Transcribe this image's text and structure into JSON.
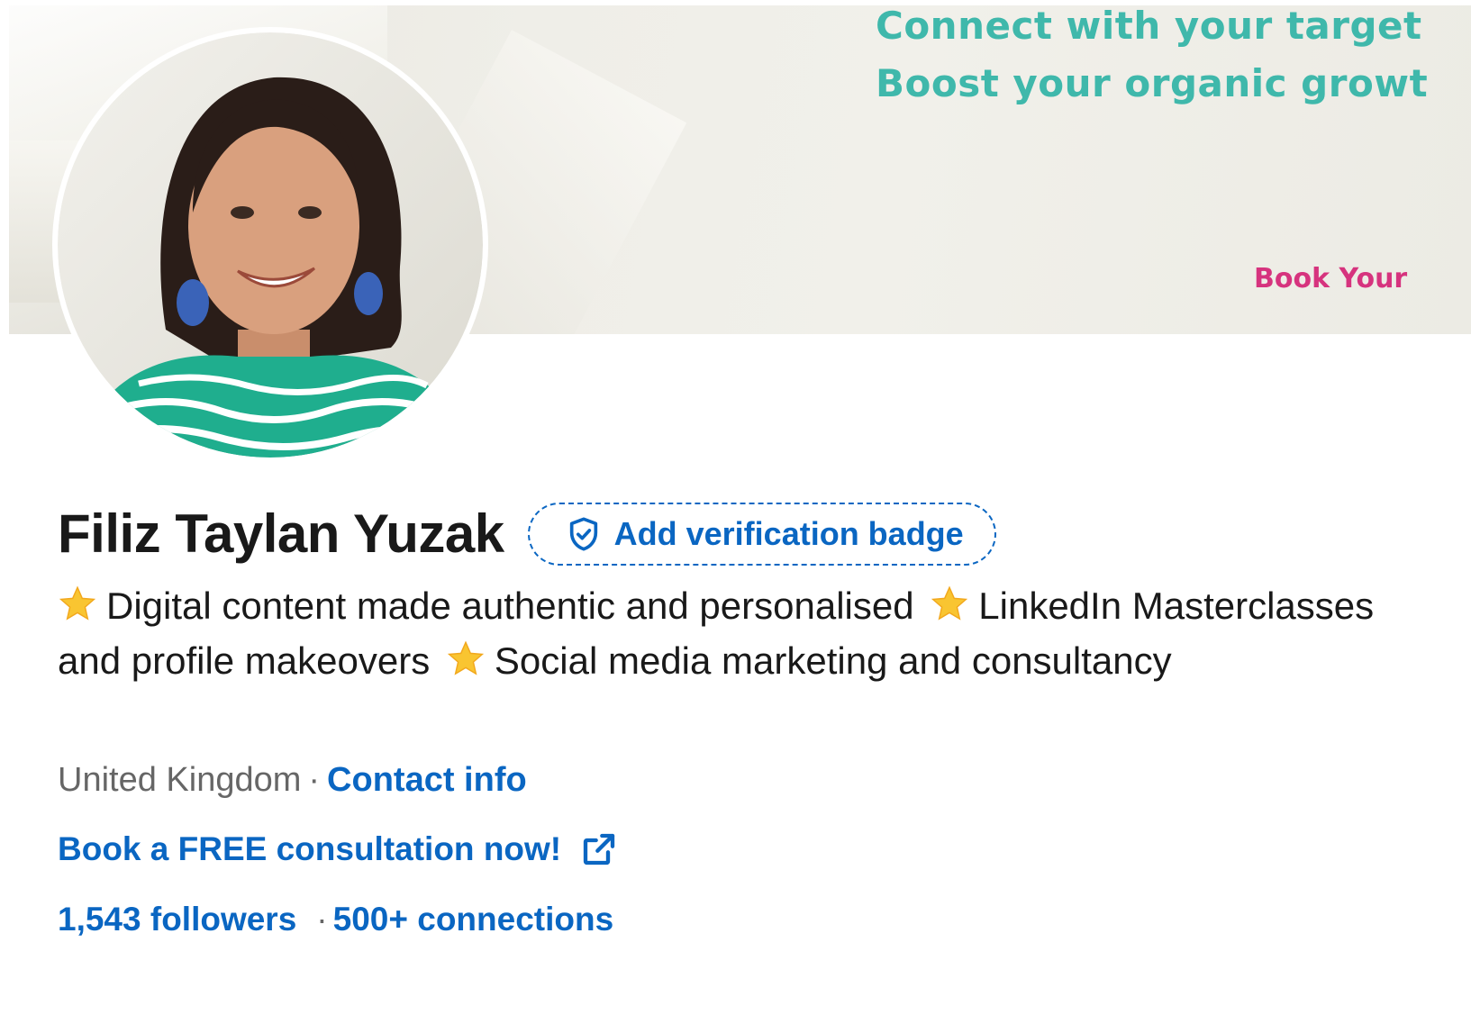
{
  "banner": {
    "line1": "Connect with your target",
    "line2": "Boost your organic growt",
    "cta": "Book Your",
    "colors": {
      "heading": "#3fb8ab",
      "cta": "#d6337e"
    }
  },
  "profile": {
    "name": "Filiz Taylan Yuzak",
    "verification_label": "Add verification badge",
    "headline": {
      "part1": "Digital content made authentic and personalised",
      "part2": "LinkedIn Masterclasses and profile makeovers",
      "part3": "Social media marketing and consultancy"
    },
    "location": "United Kingdom",
    "separator": "·",
    "contact_label": "Contact info",
    "website_label": "Book a FREE consultation now!",
    "followers": "1,543 followers",
    "connections": "500+ connections"
  },
  "icons": {
    "verify": "shield-check-icon",
    "star": "star-icon",
    "external": "external-link-icon"
  },
  "colors": {
    "link": "#0a66c2",
    "text": "#191919",
    "muted": "#666666"
  }
}
